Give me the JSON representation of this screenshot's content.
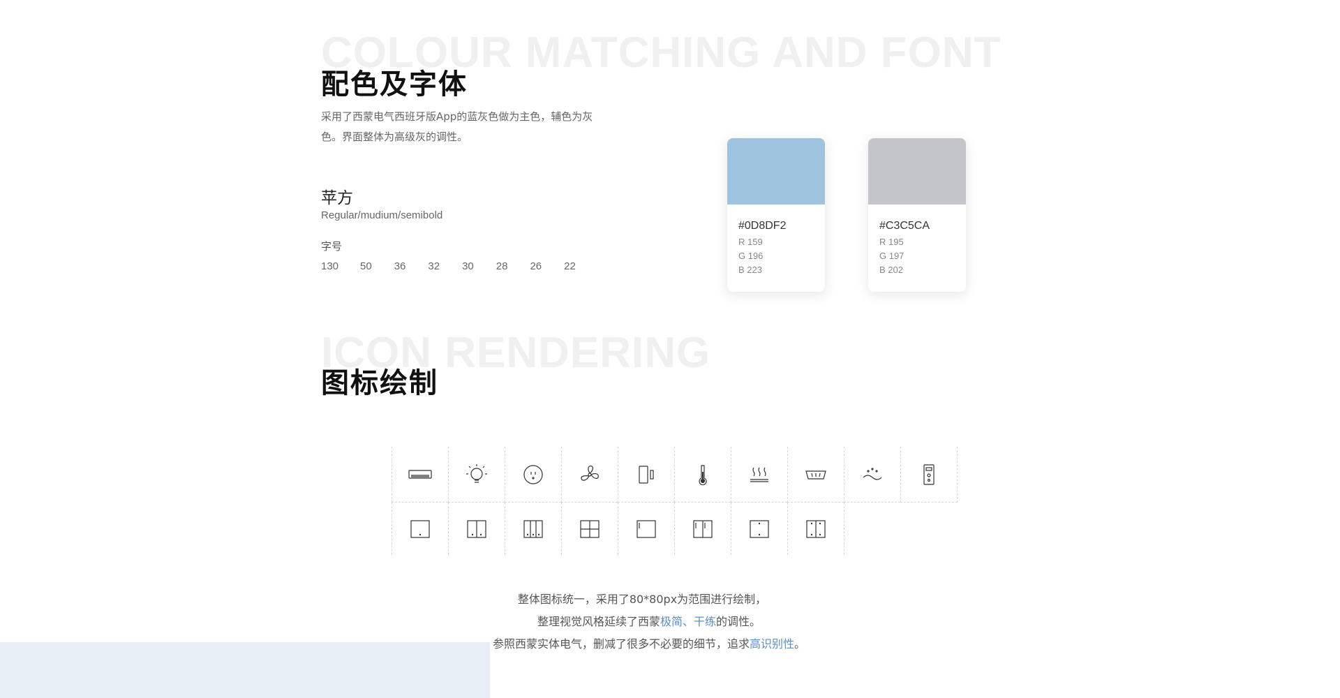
{
  "section1": {
    "bg_title": "COLOUR MATCHING AND FONT",
    "title": "配色及字体",
    "description": "采用了西蒙电气西班牙版App的蓝灰色做为主色，辅色为灰色。界面整体为高级灰的调性。",
    "font": {
      "name": "苹方",
      "weights": "Regular/mudium/semibold",
      "size_label": "字号",
      "sizes": [
        "130",
        "50",
        "36",
        "32",
        "30",
        "28",
        "26",
        "22"
      ]
    },
    "swatches": [
      {
        "hex": "#0D8DF2",
        "color": "#9FC4E0",
        "r": "R 159",
        "g": "G 196",
        "b": "B 223"
      },
      {
        "hex": "#C3C5CA",
        "color": "#C3C5CA",
        "r": "R 195",
        "g": "G 197",
        "b": "B 202"
      }
    ]
  },
  "section2": {
    "bg_title": "ICON RENDERING",
    "title": "图标绘制",
    "icons_row1": [
      "air-conditioner-icon",
      "light-bulb-icon",
      "socket-icon",
      "fan-icon",
      "door-sensor-icon",
      "thermometer-icon",
      "heater-icon",
      "bath-icon",
      "humidifier-icon",
      "controller-icon"
    ],
    "icons_row2": [
      "switch-1gang-icon",
      "switch-2gang-icon",
      "switch-3gang-icon",
      "switch-4gang-icon",
      "switch-side-icon",
      "switch-double-side-icon",
      "switch-dot-icon",
      "switch-dual-dot-icon"
    ],
    "text": {
      "line1": "整体图标统一，采用了80*80px为范围进行绘制，",
      "line2_pre": "整理视觉风格延续了西蒙",
      "line2_hl": "极简、干练",
      "line2_post": "的调性。",
      "line3_pre": "参照西蒙实体电气，删减了很多不必要的细节，追求",
      "line3_hl": "高识别性",
      "line3_post": "。"
    }
  },
  "colors": {
    "highlight": "#5b8fcb",
    "bottom_block": "#e8eef6"
  }
}
